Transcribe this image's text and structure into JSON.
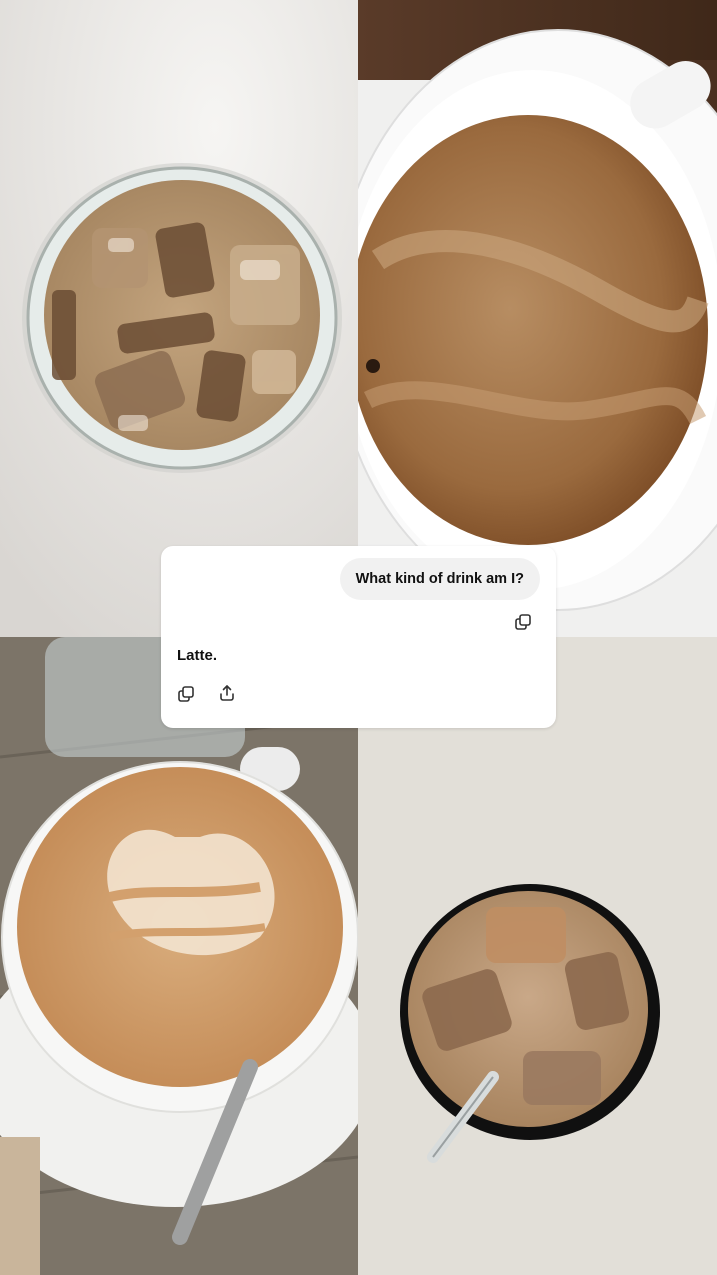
{
  "chat": {
    "user_message": "What kind of drink am I?",
    "assistant_reply": "Latte."
  },
  "photos": [
    {
      "name": "iced-latte-glass-top-view"
    },
    {
      "name": "hot-coffee-cup-crema"
    },
    {
      "name": "latte-art-cup-with-spoon"
    },
    {
      "name": "iced-coffee-with-straw"
    }
  ],
  "icons": {
    "copy_user": "copy-icon",
    "copy_reply": "copy-icon",
    "share_reply": "share-icon"
  }
}
